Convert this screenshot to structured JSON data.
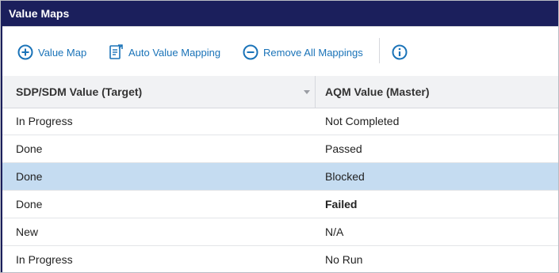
{
  "panel": {
    "title": "Value Maps"
  },
  "toolbar": {
    "add": {
      "label": "Value Map",
      "icon": "plus-circle-icon"
    },
    "auto": {
      "label": "Auto Value Mapping",
      "icon": "auto-map-icon"
    },
    "remove": {
      "label": "Remove All Mappings",
      "icon": "minus-circle-icon"
    },
    "info": {
      "icon": "info-icon"
    }
  },
  "table": {
    "columns": [
      "SDP/SDM Value (Target)",
      "AQM Value (Master)"
    ],
    "rows": [
      {
        "target": "In Progress",
        "master": "Not Completed",
        "selected": false,
        "bold": false
      },
      {
        "target": "Done",
        "master": "Passed",
        "selected": false,
        "bold": false
      },
      {
        "target": "Done",
        "master": "Blocked",
        "selected": true,
        "bold": false
      },
      {
        "target": "Done",
        "master": "Failed",
        "selected": false,
        "bold": true
      },
      {
        "target": "New",
        "master": "N/A",
        "selected": false,
        "bold": false
      },
      {
        "target": "In Progress",
        "master": "No Run",
        "selected": false,
        "bold": false
      }
    ]
  },
  "colors": {
    "titlebar": "#1b1f5c",
    "accent": "#1a73b8",
    "selected_row": "#c5dcf1",
    "header_bg": "#f1f2f4"
  }
}
